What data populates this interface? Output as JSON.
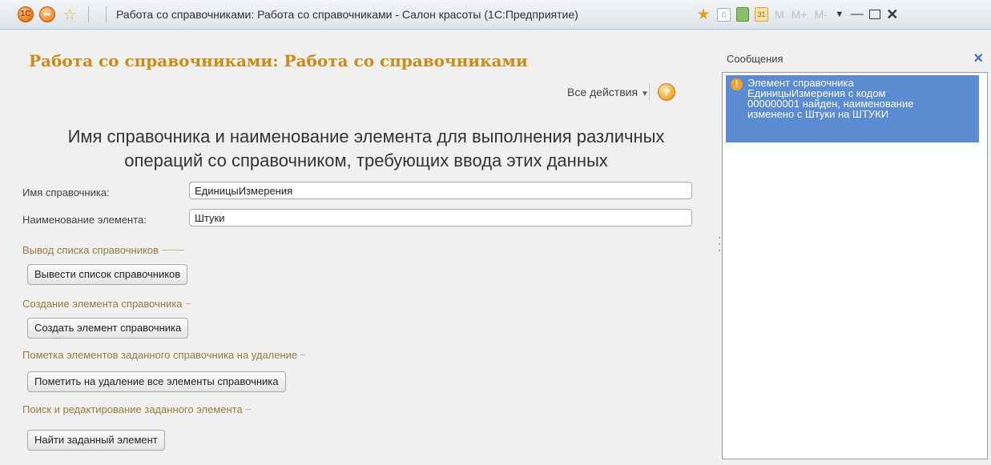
{
  "window": {
    "logo": "1С",
    "title": "Работа со справочниками: Работа со справочниками - Салон красоты  (1С:Предприятие)",
    "toolbar": [
      "M",
      "M+",
      "M-"
    ]
  },
  "form": {
    "title": "Работа со справочниками: Работа со справочниками",
    "all_actions": "Все действия",
    "help": "?",
    "heading_line1": "Имя справочника и наименование элемента для выполнения различных",
    "heading_line2": "операций со справочником, требующих ввода этих данных",
    "fields": {
      "catalog_name_label": "Имя справочника:",
      "catalog_name_value": "ЕдиницыИзмерения",
      "element_name_label": "Наименование элемента:",
      "element_name_value": "Штуки"
    },
    "groups": [
      {
        "label": "Вывод списка справочников",
        "button": "Вывести список справочников"
      },
      {
        "label": "Создание элемента справочника",
        "button": "Создать элемент справочника"
      },
      {
        "label": "Пометка элементов заданного справочника на удаление",
        "button": "Пометить на удаление все элементы справочника"
      },
      {
        "label": "Поиск и редактирование заданного элемента",
        "button": "Найти заданный элемент"
      }
    ]
  },
  "messages": {
    "title": "Сообщения",
    "close": "×",
    "items": [
      {
        "icon": "warning-icon",
        "lines": [
          "Элемент справочника",
          "ЕдиницыИзмерения с кодом",
          "000000001 найден, наименование",
          "изменено с Штуки на ШТУКИ"
        ]
      }
    ]
  },
  "colors": {
    "form_title": "#cc8a16",
    "group_label": "#9a7a3e",
    "message_highlight": "#5b8bd0",
    "close_icon": "#3b6fb8"
  }
}
